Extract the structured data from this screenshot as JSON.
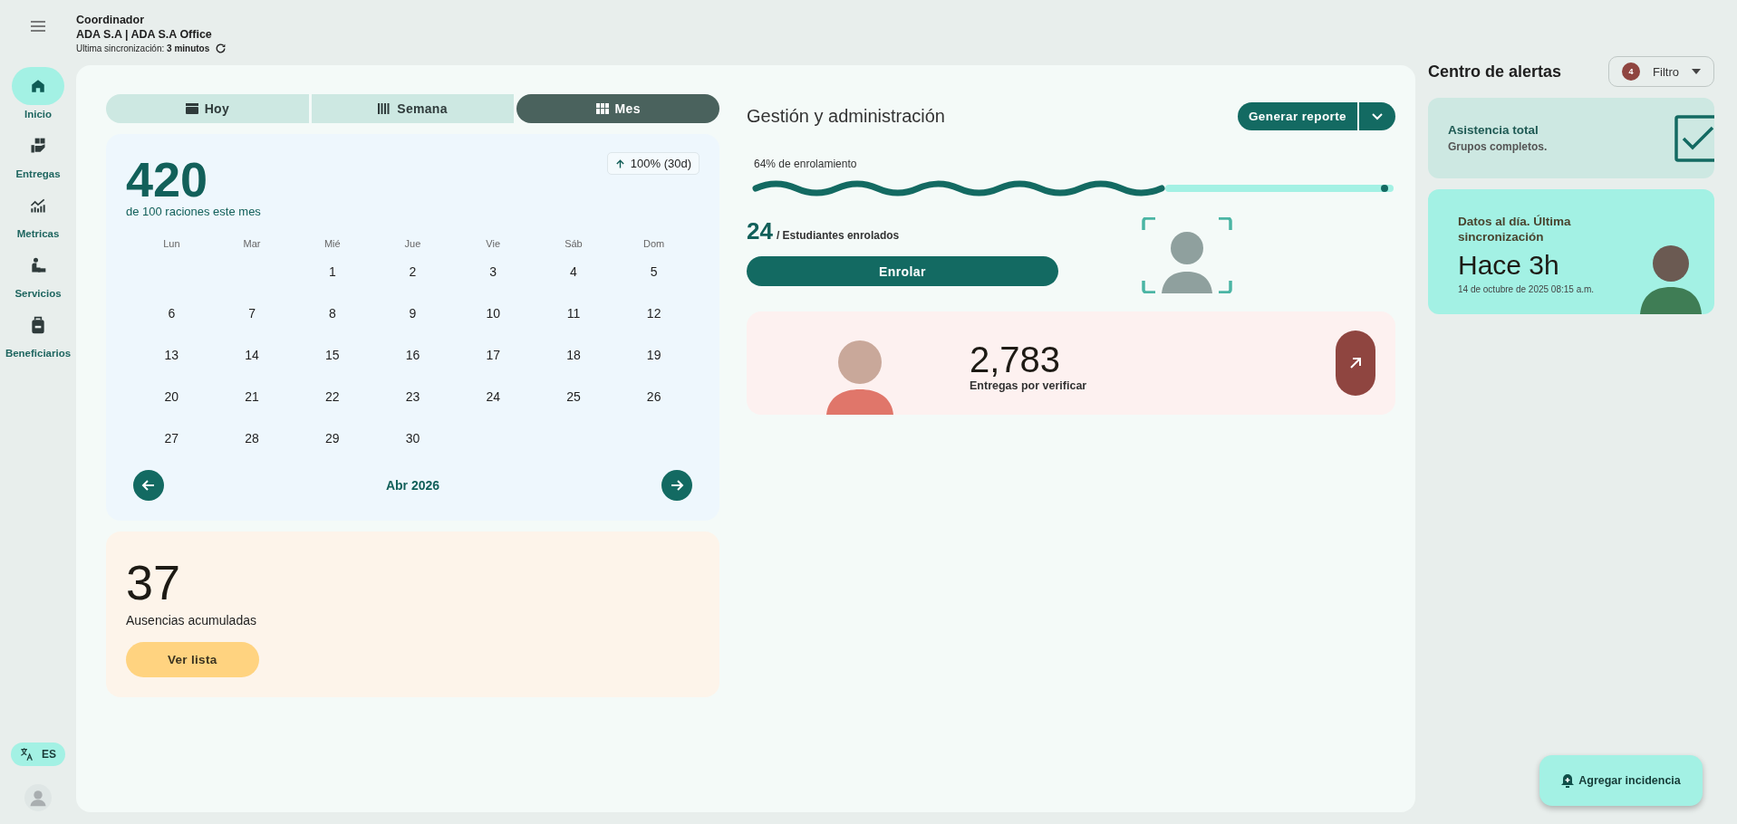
{
  "header": {
    "role": "Coordinador",
    "organization": "ADA S.A | ADA S.A Office",
    "sync_label": "Ultima sincronización:",
    "sync_value": "3 minutos"
  },
  "sidebar": {
    "items": [
      {
        "label": "Inicio",
        "selected": true
      },
      {
        "label": "Entregas",
        "selected": false
      },
      {
        "label": "Metricas",
        "selected": false
      },
      {
        "label": "Servicios",
        "selected": false
      },
      {
        "label": "Beneficiarios",
        "selected": false
      }
    ],
    "language": "ES"
  },
  "view_tabs": [
    {
      "label": "Hoy",
      "selected": false
    },
    {
      "label": "Semana",
      "selected": false
    },
    {
      "label": "Mes",
      "selected": true
    }
  ],
  "rations": {
    "value": "420",
    "caption": "de 100 raciones este mes",
    "trend": "100% (30d)"
  },
  "calendar": {
    "weekdays": [
      "Lun",
      "Mar",
      "Mié",
      "Jue",
      "Vie",
      "Sáb",
      "Dom"
    ],
    "weeks": [
      [
        "1",
        "2",
        "3",
        "4",
        "5"
      ],
      [
        "6",
        "7",
        "8",
        "9",
        "10",
        "11",
        "12"
      ],
      [
        "13",
        "14",
        "15",
        "16",
        "17",
        "18",
        "19"
      ],
      [
        "20",
        "21",
        "22",
        "23",
        "24",
        "25",
        "26"
      ],
      [
        "27",
        "28",
        "29",
        "30"
      ]
    ],
    "month": "Abr 2026"
  },
  "absences": {
    "value": "37",
    "caption": "Ausencias acumuladas",
    "button": "Ver lista"
  },
  "management": {
    "title": "Gestión y administración",
    "report_button": "Generar reporte",
    "enrollment": {
      "label": "64% de enrolamiento",
      "level": 0.64
    },
    "enrolled_count": "24",
    "enrolled_label": "/ Estudiantes enrolados",
    "enroll_button": "Enrolar"
  },
  "deliveries": {
    "value": "2,783",
    "caption": "Entregas por verificar"
  },
  "alerts": {
    "title": "Centro de alertas",
    "filter_count": "4",
    "filter_label": "Filtro",
    "cards": [
      {
        "kind": "status",
        "title": "Asistencia total",
        "text": "Grupos completos."
      },
      {
        "kind": "sync",
        "title": "Datos al día. Última sincronización",
        "value": "Hace 3h",
        "date": "14 de octubre de 2025 08:15 a.m."
      }
    ]
  },
  "fab": {
    "label": "Agregar incidencia"
  }
}
